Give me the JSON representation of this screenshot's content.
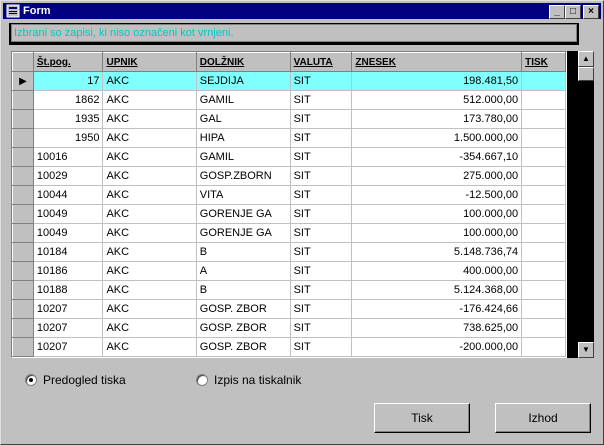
{
  "window": {
    "title": "Form",
    "min_glyph": "_",
    "max_glyph": "□",
    "close_glyph": "×",
    "icon": "form-icon"
  },
  "info_text": "Izbrani so zapisi, ki niso označeni kot vrnjeni.",
  "grid": {
    "columns": [
      "Št.pog.",
      "UPNIK",
      "DOLŽNIK",
      "VALUTA",
      "ZNESEK",
      "TISK"
    ],
    "selected_row_indicator": "▶",
    "rows": [
      {
        "stpog": "17",
        "upnik": "AKC",
        "dolznik": "SEJDIJA",
        "valuta": "SIT",
        "znesek": "198.481,50",
        "tisk": ""
      },
      {
        "stpog": "1862",
        "upnik": "AKC",
        "dolznik": "GAMIL",
        "valuta": "SIT",
        "znesek": "512.000,00",
        "tisk": ""
      },
      {
        "stpog": "1935",
        "upnik": "AKC",
        "dolznik": "GAL",
        "valuta": "SIT",
        "znesek": "173.780,00",
        "tisk": ""
      },
      {
        "stpog": "1950",
        "upnik": "AKC",
        "dolznik": "HIPA",
        "valuta": "SIT",
        "znesek": "1.500.000,00",
        "tisk": ""
      },
      {
        "stpog": "10016",
        "upnik": "AKC",
        "dolznik": "GAMIL",
        "valuta": "SIT",
        "znesek": "-354.667,10",
        "tisk": ""
      },
      {
        "stpog": "10029",
        "upnik": "AKC",
        "dolznik": "GOSP.ZBORN",
        "valuta": "SIT",
        "znesek": "275.000,00",
        "tisk": ""
      },
      {
        "stpog": "10044",
        "upnik": "AKC",
        "dolznik": "VITA",
        "valuta": "SIT",
        "znesek": "-12.500,00",
        "tisk": ""
      },
      {
        "stpog": "10049",
        "upnik": "AKC",
        "dolznik": "GORENJE GA",
        "valuta": "SIT",
        "znesek": "100.000,00",
        "tisk": ""
      },
      {
        "stpog": "10049",
        "upnik": "AKC",
        "dolznik": "GORENJE GA",
        "valuta": "SIT",
        "znesek": "100.000,00",
        "tisk": ""
      },
      {
        "stpog": "10184",
        "upnik": "AKC",
        "dolznik": "B",
        "valuta": "SIT",
        "znesek": "5.148.736,74",
        "tisk": ""
      },
      {
        "stpog": "10186",
        "upnik": "AKC",
        "dolznik": "A",
        "valuta": "SIT",
        "znesek": "400.000,00",
        "tisk": ""
      },
      {
        "stpog": "10188",
        "upnik": "AKC",
        "dolznik": "B",
        "valuta": "SIT",
        "znesek": "5.124.368,00",
        "tisk": ""
      },
      {
        "stpog": "10207",
        "upnik": "AKC",
        "dolznik": "GOSP. ZBOR",
        "valuta": "SIT",
        "znesek": "-176.424,66",
        "tisk": ""
      },
      {
        "stpog": "10207",
        "upnik": "AKC",
        "dolznik": "GOSP. ZBOR",
        "valuta": "SIT",
        "znesek": "738.625,00",
        "tisk": ""
      },
      {
        "stpog": "10207",
        "upnik": "AKC",
        "dolznik": "GOSP. ZBOR",
        "valuta": "SIT",
        "znesek": "-200.000,00",
        "tisk": ""
      }
    ]
  },
  "options": {
    "preview_label": "Predogled tiska",
    "printer_label": "Izpis na tiskalnik",
    "selected": "preview"
  },
  "buttons": {
    "print_label": "Tisk",
    "exit_label": "Izhod"
  },
  "colors": {
    "titlebar": "#000080",
    "selected_row": "#80ffff",
    "info_text": "#00c8c8"
  }
}
